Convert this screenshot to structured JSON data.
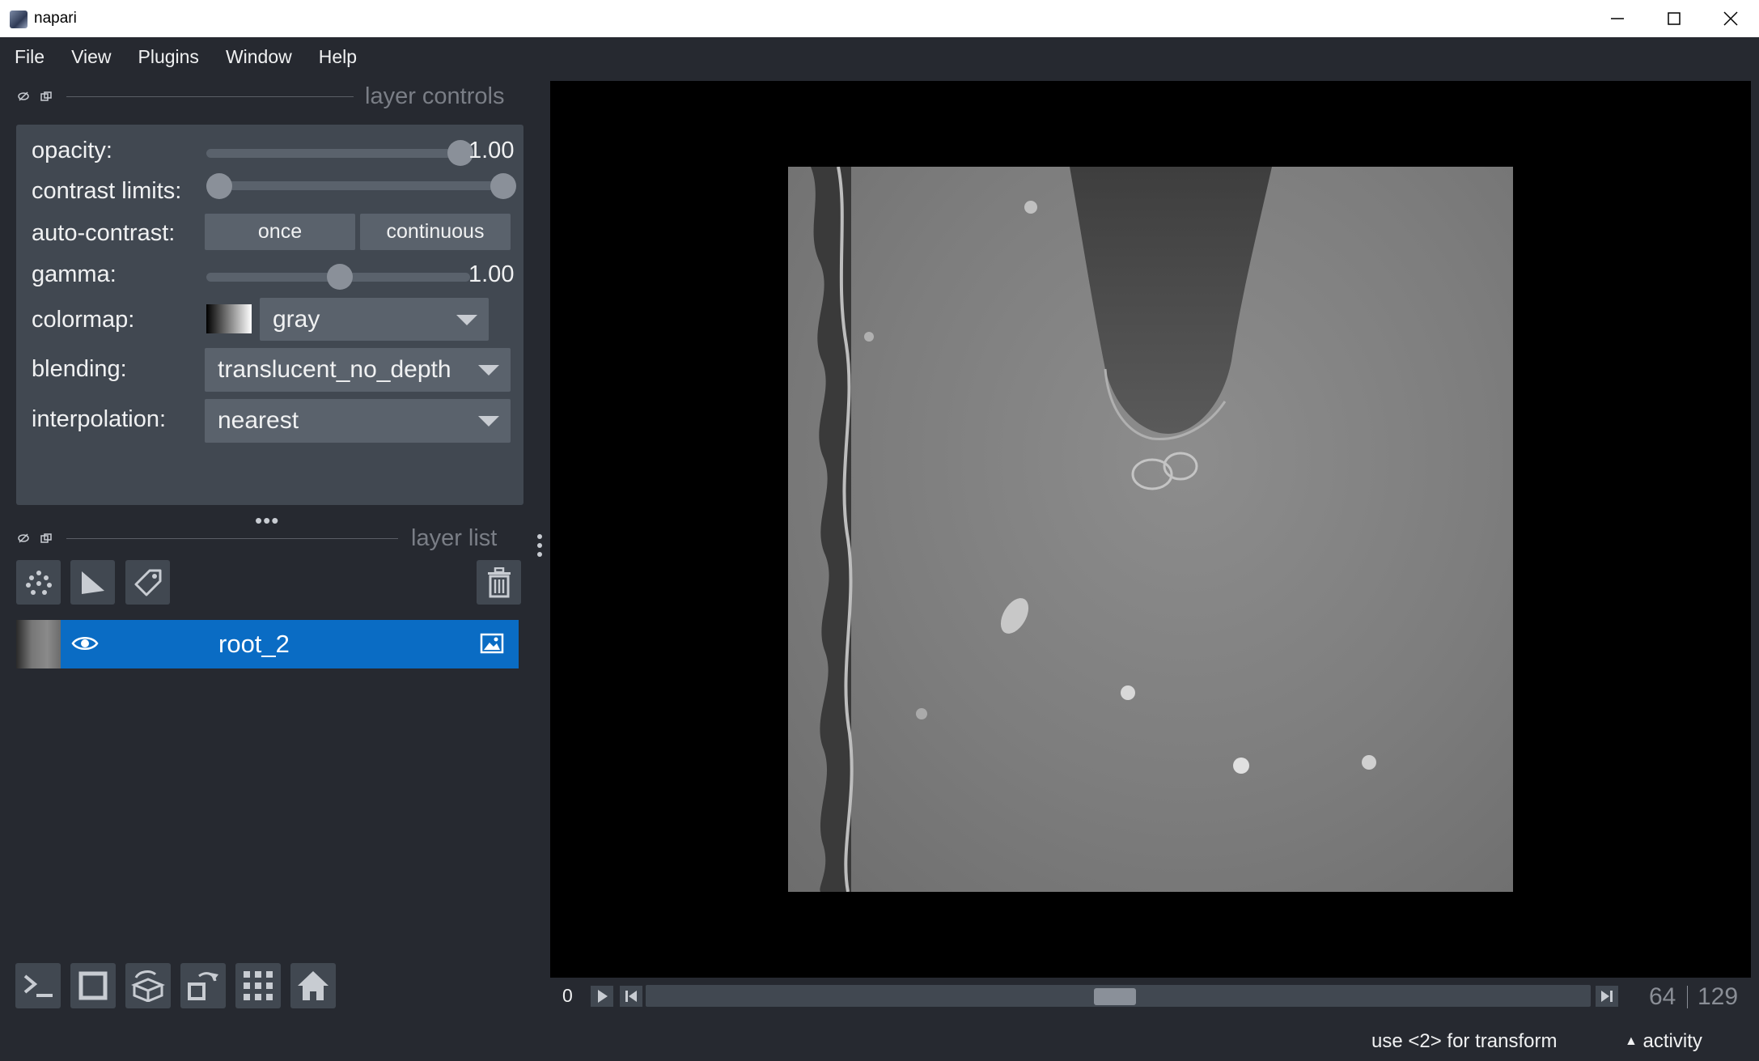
{
  "window": {
    "title": "napari"
  },
  "menu": [
    "File",
    "View",
    "Plugins",
    "Window",
    "Help"
  ],
  "layer_controls": {
    "header": "layer controls",
    "opacity": {
      "label": "opacity:",
      "value": "1.00",
      "level": 1.0
    },
    "contrast_limits": {
      "label": "contrast limits:",
      "low": 0.0,
      "high": 1.0
    },
    "auto_contrast": {
      "label": "auto-contrast:",
      "once": "once",
      "continuous": "continuous"
    },
    "gamma": {
      "label": "gamma:",
      "value": "1.00",
      "level": 0.5
    },
    "colormap": {
      "label": "colormap:",
      "value": "gray"
    },
    "blending": {
      "label": "blending:",
      "value": "translucent_no_depth"
    },
    "interpolation": {
      "label": "interpolation:",
      "value": "nearest"
    }
  },
  "layer_list": {
    "header": "layer list",
    "layers": [
      {
        "name": "root_2",
        "visible": true,
        "type_icon": "image-icon"
      }
    ]
  },
  "dims": {
    "start_label": "0",
    "current": "64",
    "total": "129",
    "position": 0.496
  },
  "status": {
    "message": "use <2> for transform",
    "activity": "activity"
  },
  "colors": {
    "background": "#262930",
    "panel": "#414851",
    "selection": "#0a6cc4",
    "canvas": "#000000"
  }
}
